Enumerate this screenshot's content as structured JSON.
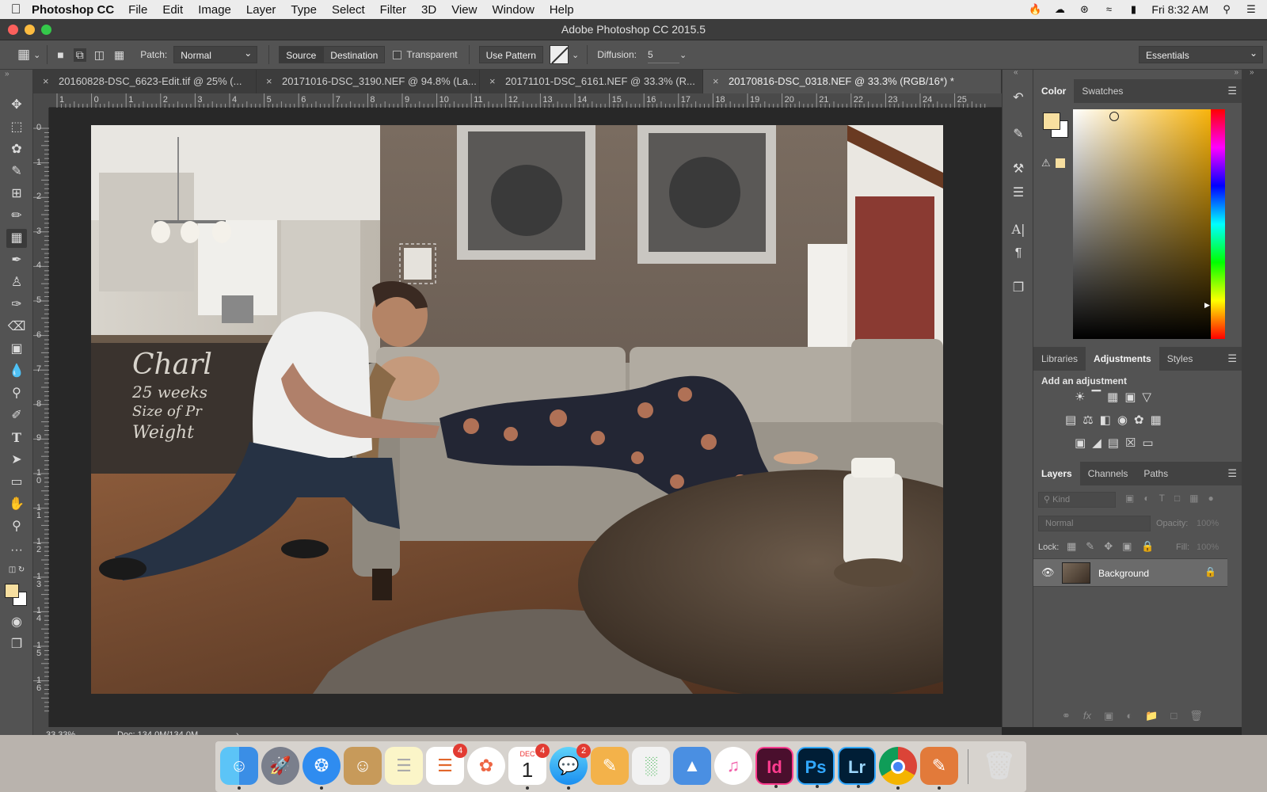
{
  "menubar": {
    "app_name": "Photoshop CC",
    "items": [
      "File",
      "Edit",
      "Image",
      "Layer",
      "Type",
      "Select",
      "Filter",
      "3D",
      "View",
      "Window",
      "Help"
    ],
    "clock": "Fri 8:32 AM"
  },
  "window": {
    "title": "Adobe Photoshop CC 2015.5"
  },
  "options": {
    "patch_label": "Patch:",
    "patch_mode": "Normal",
    "source_label": "Source",
    "destination_label": "Destination",
    "transparent_label": "Transparent",
    "use_pattern_label": "Use Pattern",
    "diffusion_label": "Diffusion:",
    "diffusion_value": "5",
    "workspace": "Essentials"
  },
  "tabs": [
    {
      "label": "20160828-DSC_6623-Edit.tif @ 25% (..."
    },
    {
      "label": "20171016-DSC_3190.NEF @ 94.8% (La..."
    },
    {
      "label": "20171101-DSC_6161.NEF @ 33.3% (R..."
    },
    {
      "label": "20170816-DSC_0318.NEF @ 33.3% (RGB/16*) *"
    }
  ],
  "ruler": {
    "h": [
      "1",
      "0",
      "1",
      "2",
      "3",
      "4",
      "5",
      "6",
      "7",
      "8",
      "9",
      "10",
      "11",
      "12",
      "13",
      "14",
      "15",
      "16",
      "17",
      "18",
      "19",
      "20",
      "21",
      "22",
      "23",
      "24",
      "25"
    ],
    "v": [
      "0",
      "1",
      "2",
      "3",
      "4",
      "5",
      "6",
      "7",
      "8",
      "9",
      "1 0",
      "1 1",
      "1 2",
      "1 3",
      "1 4",
      "1 5",
      "1 6"
    ]
  },
  "photo": {
    "chalkboard_lines": [
      "Charl",
      "25 weeks",
      "Size of Pr",
      "Weight"
    ]
  },
  "status": {
    "zoom": "33.33%",
    "doc": "Doc: 134.0M/134.0M"
  },
  "color_panel": {
    "tabs": [
      "Color",
      "Swatches"
    ],
    "foreground": "#f7dfa0",
    "background": "#ffffff"
  },
  "adjustments_panel": {
    "tabs": [
      "Libraries",
      "Adjustments",
      "Styles"
    ],
    "heading": "Add an adjustment"
  },
  "layers_panel": {
    "tabs": [
      "Layers",
      "Channels",
      "Paths"
    ],
    "filter_label": "Kind",
    "blend_mode": "Normal",
    "opacity_label": "Opacity:",
    "opacity_value": "100%",
    "lock_label": "Lock:",
    "fill_label": "Fill:",
    "fill_value": "100%",
    "layers": [
      {
        "name": "Background",
        "visible": true,
        "locked": true
      }
    ]
  },
  "dock": {
    "badges": {
      "reminders": "4",
      "calendar": "4",
      "messages": "2"
    },
    "calendar_month": "DEC",
    "calendar_day": "1",
    "apps": [
      "Finder",
      "Launchpad",
      "Safari",
      "Contacts",
      "Notes",
      "Reminders",
      "Photos",
      "Calendar",
      "Messages",
      "Pages",
      "Numbers",
      "Keynote",
      "iTunes",
      "InDesign",
      "Photoshop",
      "Lightroom",
      "Chrome",
      "Ink",
      "Trash"
    ],
    "id_label": "Id",
    "ps_label": "Ps",
    "lr_label": "Lr"
  }
}
